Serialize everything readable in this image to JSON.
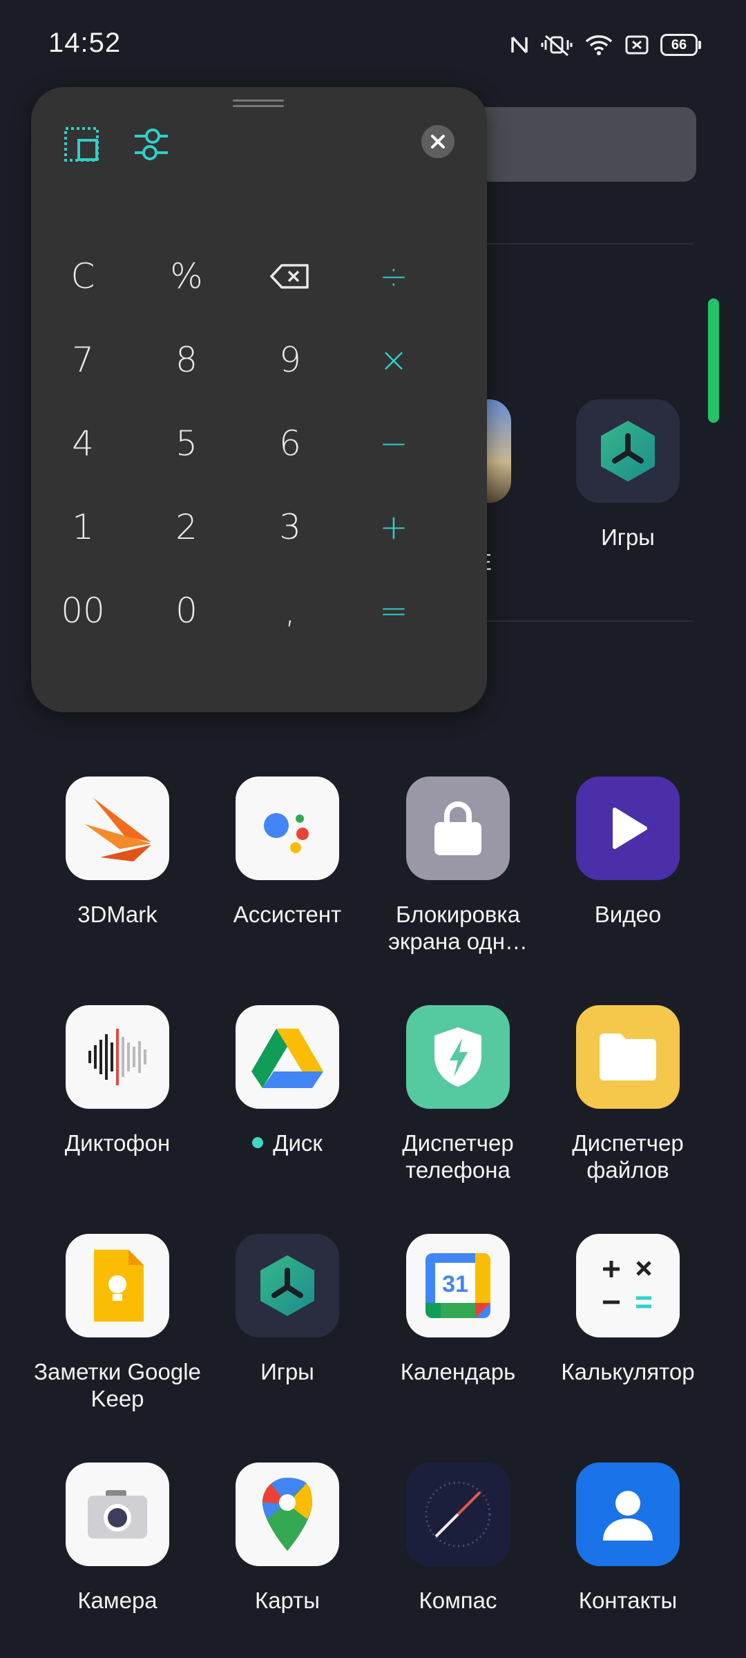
{
  "status": {
    "time": "14:52",
    "battery": "66"
  },
  "calculator": {
    "keys": [
      [
        "C",
        "%",
        "⌫",
        "÷"
      ],
      [
        "7",
        "8",
        "9",
        "×"
      ],
      [
        "4",
        "5",
        "6",
        "−"
      ],
      [
        "1",
        "2",
        "3",
        "+"
      ],
      [
        "00",
        "0",
        ",",
        "="
      ]
    ]
  },
  "partial_row": {
    "label_fragment": "E",
    "games_label": "Игры"
  },
  "apps": [
    {
      "label": "3DMark"
    },
    {
      "label": "Ассистент"
    },
    {
      "label": "Блокировка экрана одн…"
    },
    {
      "label": "Видео"
    },
    {
      "label": "Диктофон"
    },
    {
      "label": "Диск"
    },
    {
      "label": "Диспетчер телефона"
    },
    {
      "label": "Диспетчер файлов"
    },
    {
      "label": "Заметки Google Keep"
    },
    {
      "label": "Игры"
    },
    {
      "label": "Календарь",
      "badge": "31"
    },
    {
      "label": "Калькулятор"
    },
    {
      "label": "Камера"
    },
    {
      "label": "Карты"
    },
    {
      "label": "Компас"
    },
    {
      "label": "Контакты"
    }
  ]
}
